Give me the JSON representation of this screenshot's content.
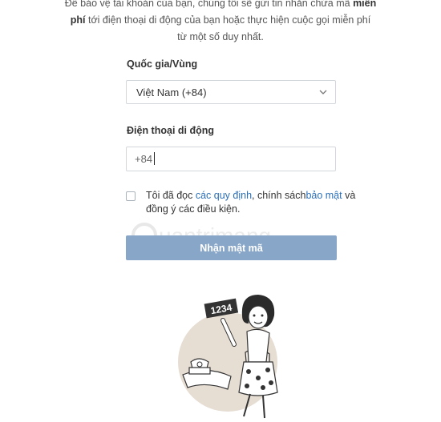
{
  "intro": {
    "line1_start": "Để bảo vệ tài khoản của bạn, chúng tôi sẽ gửi tin nhắn chứa mã ",
    "line1_bold": "miễn",
    "line2_bold": "phí",
    "line2_rest": " tới điện thoại di động của bạn hoặc thực hiện cuộc gọi miễn phí",
    "line3": "từ một số duy nhất."
  },
  "country": {
    "label": "Quốc gia/Vùng",
    "selected": "Việt Nam (+84)"
  },
  "phone": {
    "label": "Điện thoại di động",
    "value": "+84"
  },
  "terms": {
    "prefix": "Tôi đã đọc ",
    "link1": "các quy định",
    "mid": ", chính sách",
    "link2": "bảo mật",
    "suffix": " và đồng ý các điều kiện."
  },
  "submit_label": "Nhận mật mã",
  "watermark_text": "uantrimang",
  "illustration": {
    "number_card": "1234"
  },
  "colors": {
    "button": "#88a6c8",
    "link": "#2a6fb8",
    "illustration_bg": "#e6ddd3"
  }
}
